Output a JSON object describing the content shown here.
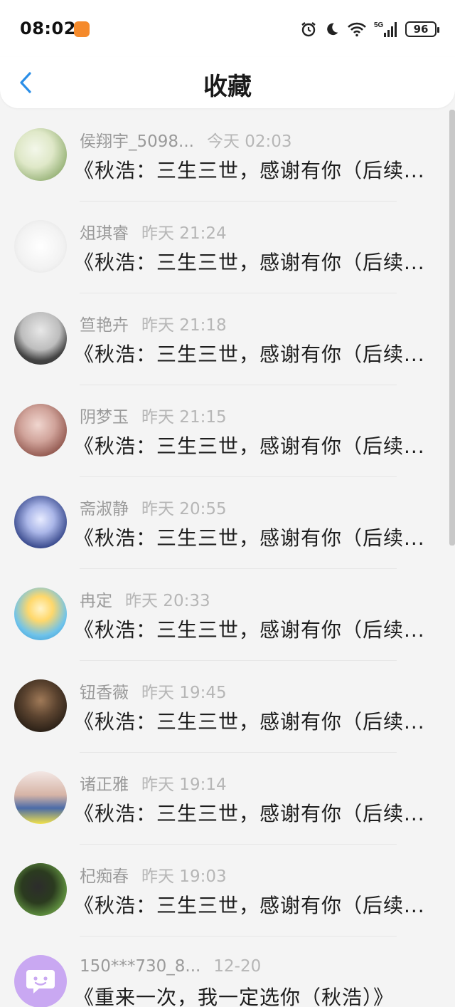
{
  "status_bar": {
    "time": "08:02",
    "network": "5G",
    "battery": "96",
    "icons": [
      "app-notification-icon",
      "alarm-icon",
      "moon-icon",
      "wifi-icon",
      "signal-icon",
      "battery-icon"
    ]
  },
  "header": {
    "title": "收藏",
    "back_icon": "chevron-left-icon",
    "accent_color": "#2b8fe8"
  },
  "items": [
    {
      "name": "侯翔宇_5098...",
      "time": "今天 02:03",
      "title": "《秋浩：三生三世，感谢有你（后续..."
    },
    {
      "name": "俎琪睿",
      "time": "昨天 21:24",
      "title": "《秋浩：三生三世，感谢有你（后续..."
    },
    {
      "name": "笪艳卉",
      "time": "昨天 21:18",
      "title": "《秋浩：三生三世，感谢有你（后续..."
    },
    {
      "name": "阴梦玉",
      "time": "昨天 21:15",
      "title": "《秋浩：三生三世，感谢有你（后续..."
    },
    {
      "name": "斋淑静",
      "time": "昨天 20:55",
      "title": "《秋浩：三生三世，感谢有你（后续..."
    },
    {
      "name": "冉定",
      "time": "昨天 20:33",
      "title": "《秋浩：三生三世，感谢有你（后续..."
    },
    {
      "name": "钮香薇",
      "time": "昨天 19:45",
      "title": "《秋浩：三生三世，感谢有你（后续..."
    },
    {
      "name": "诸正雅",
      "time": "昨天 19:14",
      "title": "《秋浩：三生三世，感谢有你（后续..."
    },
    {
      "name": "杞痴春",
      "time": "昨天 19:03",
      "title": "《秋浩：三生三世，感谢有你（后续..."
    },
    {
      "name": "150***730_8...",
      "time": "12-20",
      "title": "《重来一次，我一定选你（秋浩）》"
    }
  ]
}
